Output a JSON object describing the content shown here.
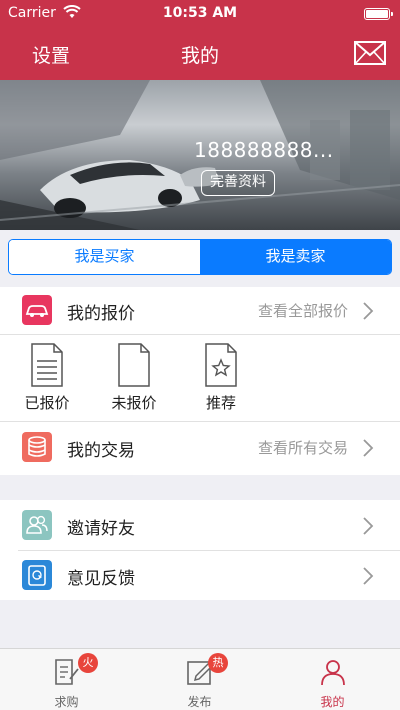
{
  "status_bar": {
    "carrier": "Carrier",
    "time": "10:53 AM"
  },
  "nav": {
    "left_label": "设置",
    "title": "我的",
    "right_icon": "mail-icon"
  },
  "profile": {
    "phone": "188888888...",
    "complete_button": "完善资料"
  },
  "segment": {
    "buyer": "我是买家",
    "seller": "我是卖家",
    "selected": "我是卖家"
  },
  "my_quotes": {
    "label": "我的报价",
    "hint": "查看全部报价",
    "icon": "car-icon",
    "icon_color": "#e8365f"
  },
  "quote_status": [
    {
      "label": "已报价",
      "icon": "document-lines-icon"
    },
    {
      "label": "未报价",
      "icon": "document-blank-icon"
    },
    {
      "label": "推荐",
      "icon": "document-star-icon"
    }
  ],
  "my_trades": {
    "label": "我的交易",
    "hint": "查看所有交易",
    "icon": "database-icon",
    "icon_color": "#ef6b5f"
  },
  "invite": {
    "label": "邀请好友",
    "icon": "people-icon",
    "icon_color": "#8cc5c0"
  },
  "feedback": {
    "label": "意见反馈",
    "icon": "mailbox-icon",
    "icon_color": "#2b88d8"
  },
  "tabbar": [
    {
      "label": "求购",
      "badge": "火",
      "icon": "edit-doc-icon",
      "active": false
    },
    {
      "label": "发布",
      "badge": "热",
      "icon": "pencil-box-icon",
      "active": false
    },
    {
      "label": "我的",
      "badge": "",
      "icon": "person-icon",
      "active": true
    }
  ],
  "colors": {
    "brand_red": "#c8334a",
    "ios_blue": "#0a7bff",
    "badge_red": "#e8453c"
  }
}
